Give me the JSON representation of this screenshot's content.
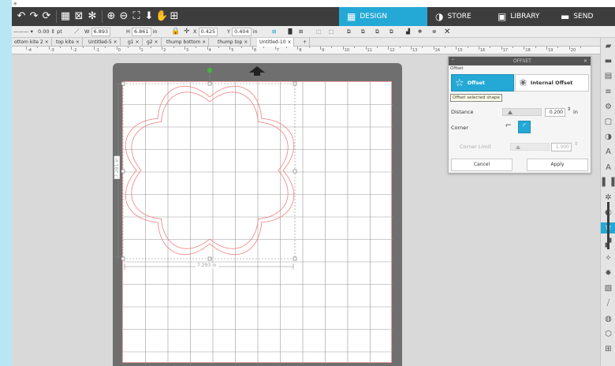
{
  "toolbar": {
    "tabs": [
      {
        "label": "DESIGN",
        "icon": "design-icon",
        "active": true
      },
      {
        "label": "STORE",
        "icon": "store-icon",
        "active": false
      },
      {
        "label": "LIBRARY",
        "icon": "library-icon",
        "active": false
      },
      {
        "label": "SEND",
        "icon": "send-icon",
        "active": false
      }
    ],
    "accent_color": "#24a9d6"
  },
  "properties": {
    "line_width_value": "0.00",
    "line_width_unit": "pt",
    "width_label": "W",
    "width_value": "6.893",
    "height_label": "H",
    "height_value": "6.861",
    "size_unit": "in",
    "x_label": "X",
    "x_value": "0.425",
    "y_label": "Y",
    "y_value": "0.404",
    "position_unit": "in"
  },
  "document_tabs": [
    {
      "label": "ottom kite 2"
    },
    {
      "label": "top kite"
    },
    {
      "label": "Untitled-5"
    },
    {
      "label": "g1"
    },
    {
      "label": "g2"
    },
    {
      "label": "thump bottom"
    },
    {
      "label": "thump top"
    },
    {
      "label": "Untitled-10",
      "selected": true
    }
  ],
  "ruler": {
    "labels": [
      "-4",
      "-3",
      "-2",
      "-1",
      "0",
      "1",
      "2",
      "3",
      "4",
      "5",
      "6",
      "7",
      "8",
      "9",
      "10",
      "11",
      "12",
      "13",
      "14",
      "15",
      "16",
      "17",
      "18",
      "19",
      "20"
    ]
  },
  "canvas": {
    "width_dimension": "7.293 in",
    "height_dimension": "7.281 in"
  },
  "offset_panel": {
    "title": "OFFSET",
    "subtitle": "Offset",
    "offset_label": "Offset",
    "internal_offset_label": "Internal Offset",
    "tooltip": "Offset selected shape",
    "distance_label": "Distance",
    "distance_value": "0.200",
    "distance_unit": "in",
    "corner_label": "Corner",
    "corner_limit_label": "Corner Limit",
    "corner_limit_value": "1.000",
    "cancel_label": "Cancel",
    "apply_label": "Apply"
  }
}
